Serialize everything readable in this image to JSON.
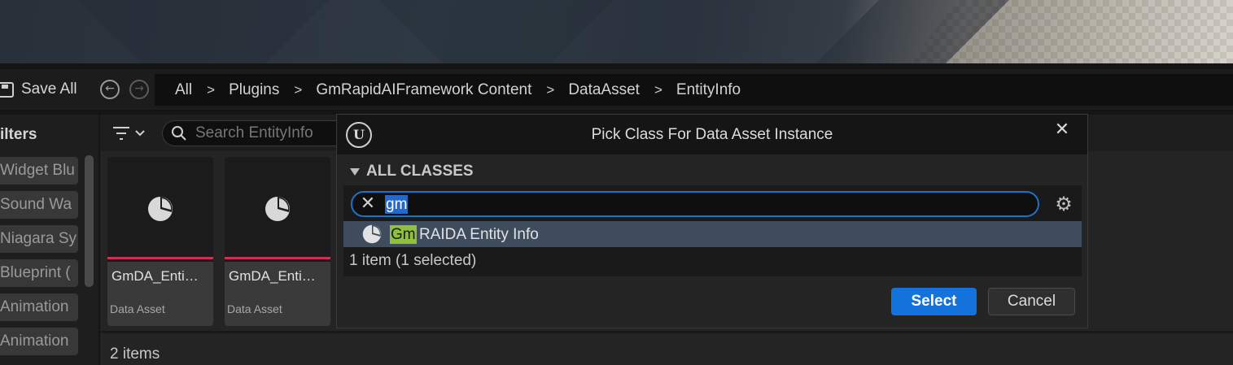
{
  "toolbar": {
    "save_all_label": "Save All",
    "back_icon": "arrow-left-circle-icon",
    "forward_icon": "arrow-right-circle-icon"
  },
  "breadcrumb": [
    "All",
    "Plugins",
    "GmRapidAIFramework Content",
    "DataAsset",
    "EntityInfo"
  ],
  "filters": {
    "title": "ilters",
    "items": [
      "Widget Blu",
      "Sound Wa",
      "Niagara Sy",
      "Blueprint (",
      "Animation",
      "Animation"
    ]
  },
  "assets": {
    "search_placeholder": "Search EntityInfo",
    "tiles": [
      {
        "name": "GmDA_Enti…",
        "type": "Data Asset"
      },
      {
        "name": "GmDA_Enti…",
        "type": "Data Asset"
      }
    ],
    "item_count": "2 items"
  },
  "modal": {
    "logo": "U",
    "title": "Pick Class For Data Asset Instance",
    "section": "ALL CLASSES",
    "search_value": "gm",
    "result": {
      "match": "Gm",
      "rest": "RAIDA Entity Info"
    },
    "result_count": "1 item (1 selected)",
    "select_label": "Select",
    "cancel_label": "Cancel"
  },
  "colors": {
    "accent_blue": "#1472dc",
    "search_highlight": "#8fc03c",
    "asset_underline": "#cc2e55",
    "selected_row": "#3e4c5e"
  }
}
